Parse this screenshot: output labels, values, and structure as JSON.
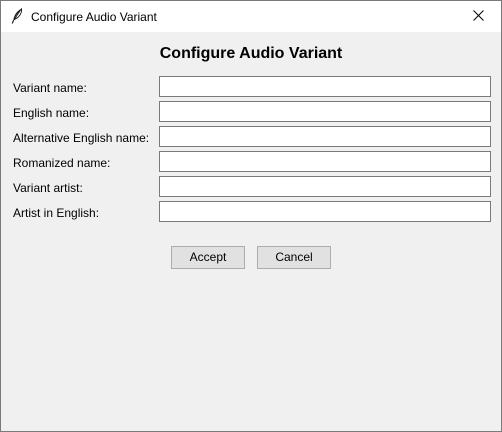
{
  "window": {
    "title": "Configure Audio Variant",
    "icon": "feather-icon",
    "close_icon": "close-icon"
  },
  "dialog": {
    "heading": "Configure Audio Variant"
  },
  "form": {
    "fields": [
      {
        "label": "Variant name:",
        "value": "",
        "placeholder": ""
      },
      {
        "label": "English name:",
        "value": "",
        "placeholder": ""
      },
      {
        "label": "Alternative English name:",
        "value": "",
        "placeholder": ""
      },
      {
        "label": "Romanized name:",
        "value": "",
        "placeholder": ""
      },
      {
        "label": "Variant artist:",
        "value": "",
        "placeholder": ""
      },
      {
        "label": "Artist in English:",
        "value": "",
        "placeholder": ""
      }
    ]
  },
  "buttons": {
    "accept_label": "Accept",
    "cancel_label": "Cancel"
  }
}
